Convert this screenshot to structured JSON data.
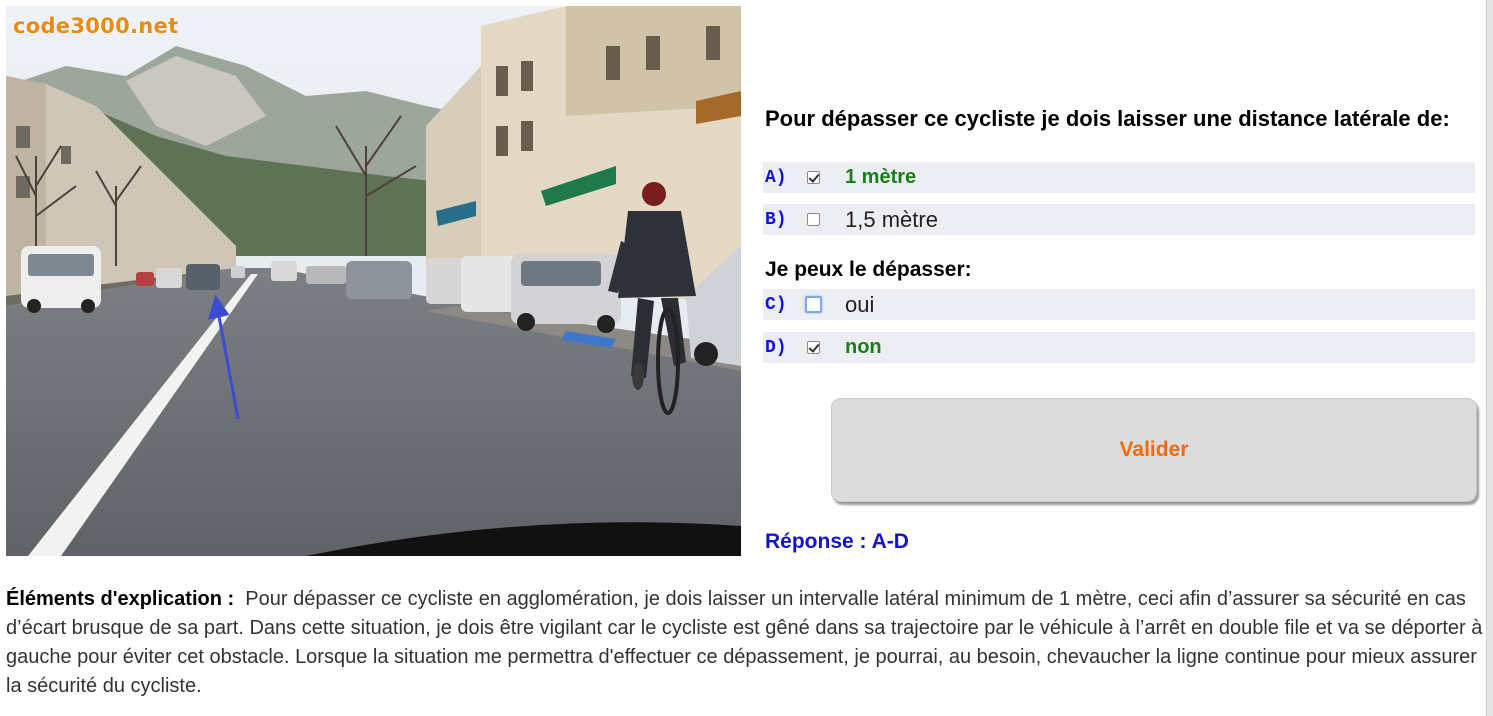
{
  "site": {
    "logo": "code3000.net"
  },
  "question": {
    "text": "Pour dépasser ce cycliste je dois laisser une distance latérale de:"
  },
  "options": [
    {
      "letter": "A)",
      "label": "1 mètre",
      "checked": true,
      "correct": true
    },
    {
      "letter": "B)",
      "label": "1,5 mètre",
      "checked": false,
      "correct": false
    },
    {
      "letter": "C)",
      "label": "oui",
      "checked": false,
      "correct": false
    },
    {
      "letter": "D)",
      "label": "non",
      "checked": true,
      "correct": true
    }
  ],
  "subquestion": {
    "text": "Je peux le dépasser:"
  },
  "button": {
    "label": "Valider"
  },
  "answer": {
    "text": "Réponse : A-D"
  },
  "explanation": {
    "title": "Éléments d'explication :",
    "body": "Pour dépasser ce cycliste en agglomération, je dois laisser un intervalle latéral minimum de 1 mètre, ceci afin d’assurer sa sécurité en cas d’écart brusque de sa part. Dans cette situation, je dois être vigilant car le cycliste est gêné dans sa trajectoire par le véhicule à l’arrêt en double file et va se déporter à gauche pour éviter cet obstacle. Lorsque la situation me permettra d'effectuer ce dépassement, je pourrai, au besoin, chevaucher la ligne continue pour mieux assurer la sécurité du cycliste."
  },
  "colors": {
    "option_letter": "#1212d8",
    "correct": "#1a7d1a",
    "button_text": "#f26b0e",
    "answer": "#1414c8"
  }
}
